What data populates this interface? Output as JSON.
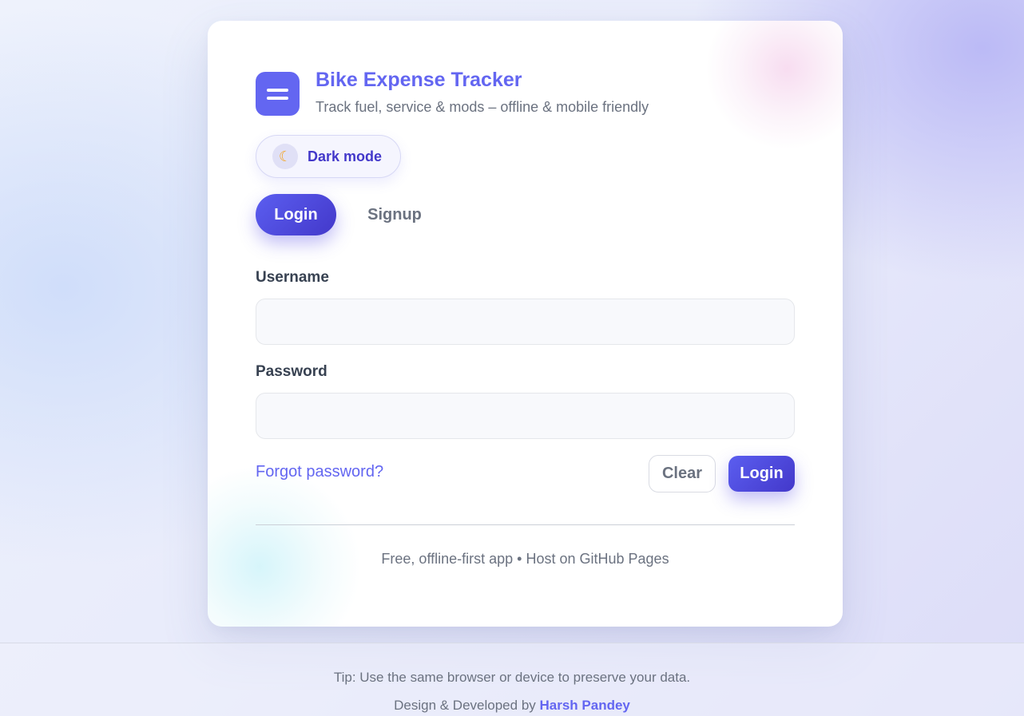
{
  "app": {
    "title": "Bike Expense Tracker",
    "subtitle": "Track fuel, service & mods – offline & mobile friendly",
    "icon": "menu-icon",
    "accent_color": "#6366f1"
  },
  "theme_toggle": {
    "label": "Dark mode",
    "icon": "moon-icon"
  },
  "tabs": [
    {
      "label": "Login",
      "active": true
    },
    {
      "label": "Signup",
      "active": false
    }
  ],
  "form": {
    "username_label": "Username",
    "username_value": "",
    "password_label": "Password",
    "password_value": "",
    "forgot_link": "Forgot password?",
    "clear_button": "Clear",
    "submit_button": "Login"
  },
  "card_note": "Free, offline-first app • Host on GitHub Pages",
  "footer": {
    "tip": "Tip: Use the same browser or device to preserve your data.",
    "credit_prefix": "Design & Developed by ",
    "author": "Harsh Pandey"
  }
}
